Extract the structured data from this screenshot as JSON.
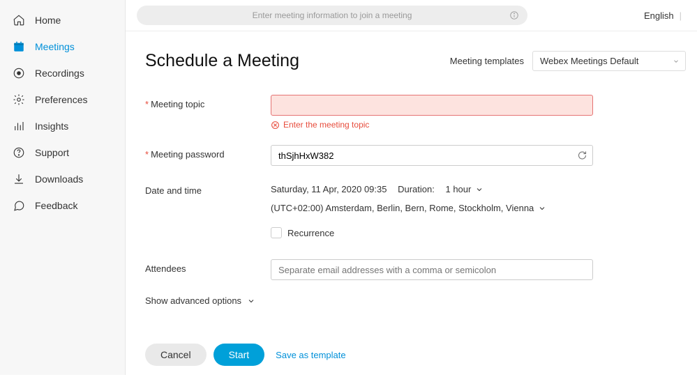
{
  "sidebar": {
    "items": [
      {
        "label": "Home"
      },
      {
        "label": "Meetings"
      },
      {
        "label": "Recordings"
      },
      {
        "label": "Preferences"
      },
      {
        "label": "Insights"
      },
      {
        "label": "Support"
      },
      {
        "label": "Downloads"
      },
      {
        "label": "Feedback"
      }
    ]
  },
  "topbar": {
    "search_placeholder": "Enter meeting information to join a meeting",
    "language": "English"
  },
  "page": {
    "title": "Schedule a Meeting",
    "templates_label": "Meeting templates",
    "template_selected": "Webex Meetings Default"
  },
  "form": {
    "topic_label": "Meeting topic",
    "topic_error": "Enter the meeting topic",
    "password_label": "Meeting password",
    "password_value": "thSjhHxW382",
    "date_label": "Date and time",
    "date_value": "Saturday, 11 Apr, 2020 09:35",
    "duration_label": "Duration:",
    "duration_value": "1 hour",
    "timezone": "(UTC+02:00) Amsterdam, Berlin, Bern, Rome, Stockholm, Vienna",
    "recurrence_label": "Recurrence",
    "attendees_label": "Attendees",
    "attendees_placeholder": "Separate email addresses with a comma or semicolon",
    "advanced_label": "Show advanced options"
  },
  "actions": {
    "cancel": "Cancel",
    "start": "Start",
    "save_template": "Save as template"
  }
}
